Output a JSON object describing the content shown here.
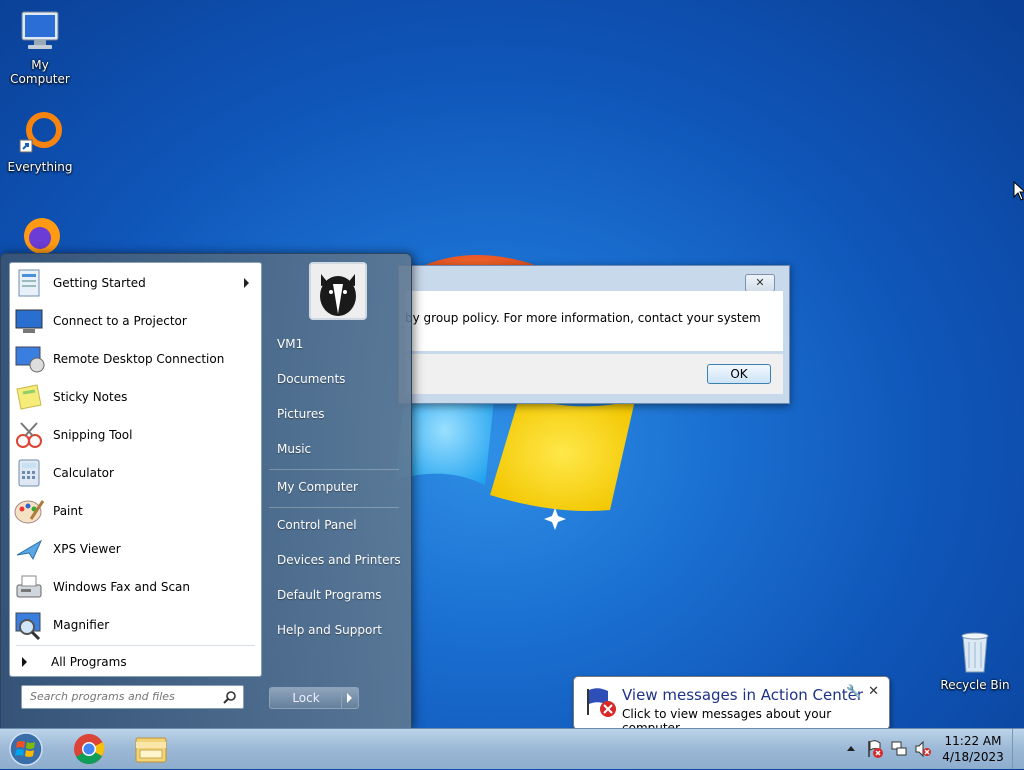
{
  "desktop": {
    "icons": [
      {
        "label": "My Computer"
      },
      {
        "label": "Everything"
      },
      {
        "label": "Recycle Bin"
      }
    ]
  },
  "dialog": {
    "message": "by group policy. For more information, contact your system",
    "ok_label": "OK",
    "close_glyph": "✕"
  },
  "start_menu": {
    "programs": [
      {
        "label": "Getting Started",
        "icon": "getting-started-icon",
        "submenu": true
      },
      {
        "label": "Connect to a Projector",
        "icon": "projector-icon"
      },
      {
        "label": "Remote Desktop Connection",
        "icon": "remote-desktop-icon"
      },
      {
        "label": "Sticky Notes",
        "icon": "sticky-notes-icon"
      },
      {
        "label": "Snipping Tool",
        "icon": "snipping-tool-icon"
      },
      {
        "label": "Calculator",
        "icon": "calculator-icon"
      },
      {
        "label": "Paint",
        "icon": "paint-icon"
      },
      {
        "label": "XPS Viewer",
        "icon": "xps-viewer-icon"
      },
      {
        "label": "Windows Fax and Scan",
        "icon": "fax-scan-icon"
      },
      {
        "label": "Magnifier",
        "icon": "magnifier-icon"
      }
    ],
    "all_programs": "All Programs",
    "search_placeholder": "Search programs and files",
    "right_items": [
      "VM1",
      "Documents",
      "Pictures",
      "Music",
      "My Computer",
      "Control Panel",
      "Devices and Printers",
      "Default Programs",
      "Help and Support"
    ],
    "lock_label": "Lock"
  },
  "balloon": {
    "title": "View messages in Action Center",
    "subtitle": "Click to view messages about your computer."
  },
  "taskbar": {
    "time": "11:22 AM",
    "date": "4/18/2023",
    "pinned": [
      "chrome-icon",
      "explorer-icon"
    ]
  }
}
